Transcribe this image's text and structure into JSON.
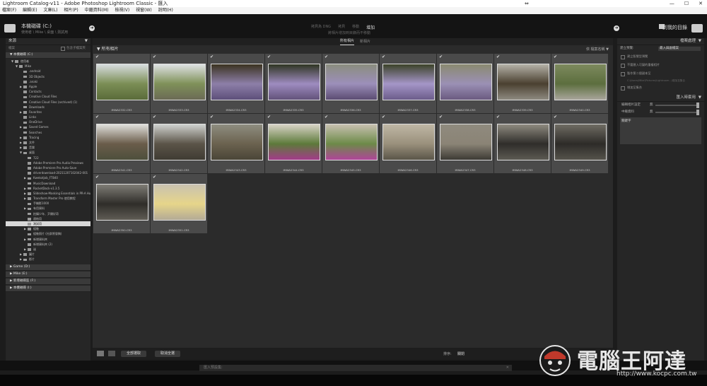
{
  "window": {
    "title": "Lightroom Catalog-v11 - Adobe Photoshop Lightroom Classic - 匯入",
    "controls": [
      "—",
      "☐",
      "✕"
    ],
    "resize_glyph": "⇔"
  },
  "menu": [
    "檔案(F)",
    "編輯(E)",
    "文庫(L)",
    "相片(P)",
    "中繼資料(M)",
    "檢視(V)",
    "視窗(W)",
    "說明(H)"
  ],
  "source_header": {
    "title": "本機磁碟 (C:)",
    "subtitle": "使用者 \\ Mike \\ 桌面 \\ 測試用"
  },
  "modes": {
    "items": [
      "拷貝為 DNG",
      "拷貝",
      "移動",
      "增加"
    ],
    "active": "增加",
    "subtitle": "將相片增加到目錄而不移動"
  },
  "destination": {
    "label": "到我的目錄"
  },
  "view_tabs": [
    "所有相片",
    "新相片"
  ],
  "left_panel": {
    "header": "來源",
    "subheader": "檔案",
    "include_label": "包含子檔案夾",
    "volumes_top": [
      {
        "label": "本機磁碟 (C:)"
      }
    ],
    "tree": [
      {
        "label": "使用者",
        "indent": 1,
        "tri": "▼"
      },
      {
        "label": "Mike",
        "indent": 2,
        "tri": "▼"
      },
      {
        "label": ".android",
        "indent": 3,
        "tri": ""
      },
      {
        "label": "3D Objects",
        "indent": 3,
        "tri": ""
      },
      {
        "label": ".anaki",
        "indent": 3,
        "tri": ""
      },
      {
        "label": "Apple",
        "indent": 3,
        "tri": "▶"
      },
      {
        "label": "Contacts",
        "indent": 3,
        "tri": ""
      },
      {
        "label": "Creative Cloud Files",
        "indent": 3,
        "tri": ""
      },
      {
        "label": "Creative Cloud Files (archived) (1)",
        "indent": 3,
        "tri": ""
      },
      {
        "label": "Downloads",
        "indent": 3,
        "tri": ""
      },
      {
        "label": "Favorites",
        "indent": 3,
        "tri": "▶"
      },
      {
        "label": "Links",
        "indent": 3,
        "tri": ""
      },
      {
        "label": "OneDrive",
        "indent": 3,
        "tri": ""
      },
      {
        "label": "Saved Games",
        "indent": 3,
        "tri": "▶"
      },
      {
        "label": "Searches",
        "indent": 3,
        "tri": ""
      },
      {
        "label": "Tracing",
        "indent": 3,
        "tri": "▶"
      },
      {
        "label": "文件",
        "indent": 3,
        "tri": "▶"
      },
      {
        "label": "音樂",
        "indent": 3,
        "tri": "▶"
      },
      {
        "label": "桌面",
        "indent": 3,
        "tri": "▼"
      },
      {
        "label": "722",
        "indent": 4,
        "tri": ""
      },
      {
        "label": "Adobe Premiere Pro Audio Previews",
        "indent": 4,
        "tri": ""
      },
      {
        "label": "Adobe Premiere Pro Auto-Save",
        "indent": 4,
        "tri": ""
      },
      {
        "label": "driverdownload-20211207102042-001",
        "indent": 4,
        "tri": ""
      },
      {
        "label": "Kwekotjob_FT840",
        "indent": 4,
        "tri": "▶"
      },
      {
        "label": "MusicDownload",
        "indent": 4,
        "tri": ""
      },
      {
        "label": "RocketDock-v1.3.5",
        "indent": 4,
        "tri": "▶"
      },
      {
        "label": "Slideshow-Masking Essentials in PR-A Hunt I...",
        "indent": 4,
        "tri": "▶"
      },
      {
        "label": "Transform Master Pro 使用教程",
        "indent": 4,
        "tri": "▶"
      },
      {
        "label": "手機影1000",
        "indent": 4,
        "tri": ""
      },
      {
        "label": "有用資料",
        "indent": 4,
        "tri": "▶"
      },
      {
        "label": "拍攝少年、尹類好奇",
        "indent": 4,
        "tri": ""
      },
      {
        "label": "連結用",
        "indent": 4,
        "tri": ""
      },
      {
        "label": "測試用",
        "indent": 4,
        "tri": "",
        "selected": true
      },
      {
        "label": "組裝",
        "indent": 4,
        "tri": "▶"
      },
      {
        "label": "組裝照片 (社群將發稿)",
        "indent": 4,
        "tri": ""
      },
      {
        "label": "新增資料夾",
        "indent": 4,
        "tri": "▶"
      },
      {
        "label": "新增資料夾 (2)",
        "indent": 4,
        "tri": ""
      },
      {
        "label": "迷",
        "indent": 4,
        "tri": "▶"
      },
      {
        "label": "圖片",
        "indent": 3,
        "tri": "▶"
      },
      {
        "label": "影片",
        "indent": 3,
        "tri": "▶"
      }
    ],
    "volumes_bottom": [
      {
        "label": "Game (D:)"
      },
      {
        "label": "Mike (E:)"
      },
      {
        "label": "新增磁碟區 (F:)"
      },
      {
        "label": "本機磁碟 (I:)"
      }
    ],
    "bottom_button": "+",
    "bottom_text": "從 相片資料夾 / 桌面 / 測試用"
  },
  "grid": {
    "header": "所有相片",
    "sort_label": "依 檔案名稱",
    "photos": [
      {
        "name": "IMWA2332.CR3",
        "sky": "#d8dde0",
        "ground": "#5a6b3a",
        "accent": "#7b8e55"
      },
      {
        "name": "IMWA2333.CR3",
        "sky": "#dfe2e4",
        "ground": "#6b6a55",
        "accent": "#7f9159"
      },
      {
        "name": "IMWA2334.CR3",
        "sky": "#3b3320",
        "ground": "#5d4f7a",
        "accent": "#8d7fa8"
      },
      {
        "name": "IMWA2335.CR3",
        "sky": "#2f3522",
        "ground": "#62527a",
        "accent": "#9e8cc0"
      },
      {
        "name": "IMWA2336.CR3",
        "sky": "#8a8d7e",
        "ground": "#5b4b72",
        "accent": "#9c8fba"
      },
      {
        "name": "IMWA2337.CR3",
        "sky": "#3b4228",
        "ground": "#6b5c8a",
        "accent": "#a596c8"
      },
      {
        "name": "IMWA2338.CR3",
        "sky": "#8a8a70",
        "ground": "#6a5a80",
        "accent": "#9b90b5"
      },
      {
        "name": "IMWA2339.CR3",
        "sky": "#b5b2a8",
        "ground": "#8e8a80",
        "accent": "#4a4030"
      },
      {
        "name": "IMWA2340.CR3",
        "sky": "#7d8a5e",
        "ground": "#a8a59a",
        "accent": "#5c6e3e"
      },
      {
        "name": "IMWA2341.CR3",
        "sky": "#e0e0dc",
        "ground": "#4d4f3c",
        "accent": "#6a5c4a"
      },
      {
        "name": "IMWA2342.CR3",
        "sky": "#cfd2cf",
        "ground": "#3f3b33",
        "accent": "#5b5448"
      },
      {
        "name": "IMWA2343.CR3",
        "sky": "#8e8d80",
        "ground": "#4a4537",
        "accent": "#6b624f"
      },
      {
        "name": "IMWA2344.CR3",
        "sky": "#d8d3c6",
        "ground": "#a33b8a",
        "accent": "#5d7a3a"
      },
      {
        "name": "IMWA2345.CR3",
        "sky": "#c8c0b0",
        "ground": "#b04599",
        "accent": "#6c8a48"
      },
      {
        "name": "IMWA2346.CR3",
        "sky": "#bfb7a5",
        "ground": "#5a5548",
        "accent": "#9a907c"
      },
      {
        "name": "IMWA2347.CR3",
        "sky": "#8f8a7e",
        "ground": "#3c3a34",
        "accent": "#8b8476"
      },
      {
        "name": "IMWA2348.CR3",
        "sky": "#8e8a7f",
        "ground": "#5c5a52",
        "accent": "#2f2d2a"
      },
      {
        "name": "IMWA2349.CR3",
        "sky": "#6f6c63",
        "ground": "#55534b",
        "accent": "#2d2b28"
      },
      {
        "name": "IMWA2350.CR3",
        "sky": "#7f7d76",
        "ground": "#5f5c55",
        "accent": "#2f2d29"
      },
      {
        "name": "IMWA2351.CR3",
        "sky": "#c9c2b0",
        "ground": "#b3aa95",
        "accent": "#e6d58a"
      }
    ]
  },
  "footer": {
    "btn_check_all": "全部選取",
    "btn_uncheck_all": "取消全選",
    "sort_label": "排序:",
    "sort_value": "關閉"
  },
  "right_panel": {
    "file_handling_header": "檔案處理",
    "build_previews_label": "建立預覽:",
    "build_previews_value": "最入與副檔案",
    "checks": [
      "建立智慧型預覽",
      "不要匯入可疑的重複相片",
      "製作第二個副本至",
      "增加至集合"
    ],
    "second_copy_path": "C:\\Users\\Mike\\Pictures\\Lightroom...\\增加至集合",
    "apply_header": "匯入時套用",
    "develop_label": "編輯相片設定",
    "develop_value": "無",
    "metadata_label": "中繼資料",
    "metadata_value": "無",
    "keywords_label": "關鍵字"
  },
  "search": {
    "placeholder": "匯入預設集:",
    "clear": "✕"
  },
  "watermark": {
    "brand": "電腦王阿達",
    "url": "http://www.kocpc.com.tw"
  }
}
